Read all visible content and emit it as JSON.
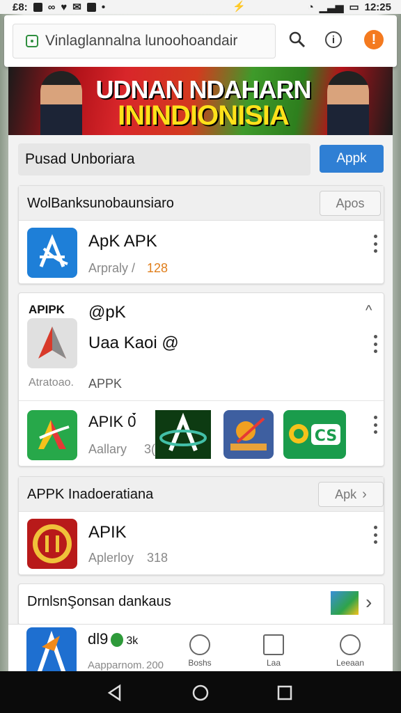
{
  "status_bar": {
    "time_left": "£8:",
    "center_icon": "⚡",
    "time": "12:25"
  },
  "address_bar": {
    "url": "Vinlaglannalna lunoohoandair"
  },
  "banner": {
    "line1": "UDNAN NDAHARN",
    "line2": "ININDIONISIA"
  },
  "search": {
    "value": "Pusad Unboriara",
    "button": "Apрk"
  },
  "section1": {
    "title": "WolBanksunobaunsiaro",
    "button": "Apos",
    "app": {
      "name": "ApK APK",
      "meta": "Arpraly /",
      "count": "128"
    }
  },
  "section2": {
    "badge": "APIPK",
    "label": "@pK",
    "caret": "^",
    "name": "Uaa Kaoi @",
    "caption": "Atratoao.",
    "tag": "APPK",
    "row": {
      "name": "APIK 0́̀",
      "meta": "Aallary",
      "count": "3("
    }
  },
  "section3": {
    "title": "APPK Inadoeratiana",
    "button": "Apk",
    "app": {
      "name": "APIK",
      "meta": "Aplerloy",
      "count": "318"
    }
  },
  "section4": {
    "title": "DrnlsnŞonsan dankaus"
  },
  "partial_app": {
    "name": "dl9",
    "name_tail": "3k",
    "meta": "Aapparnom.",
    "count": "200"
  },
  "bottom_nav": [
    {
      "label": "Boshs"
    },
    {
      "label": "Laa"
    },
    {
      "label": "Leeaan"
    }
  ],
  "colors": {
    "primary": "#2f7fd4",
    "warning": "#f47a1f",
    "accent_orange": "#e07e1b"
  }
}
